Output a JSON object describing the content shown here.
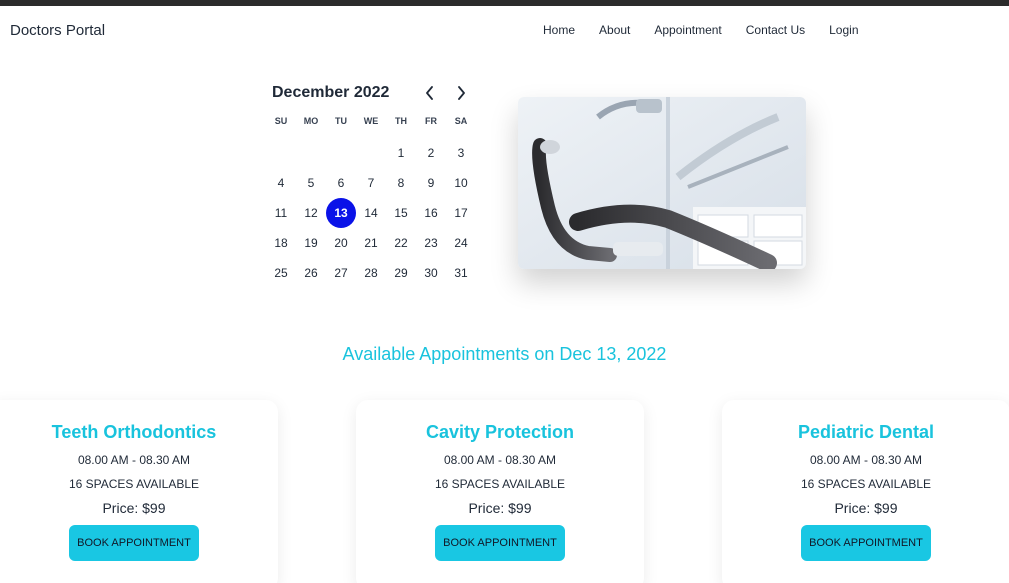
{
  "brand": "Doctors Portal",
  "nav": {
    "home": "Home",
    "about": "About",
    "appointment": "Appointment",
    "contact": "Contact Us",
    "login": "Login"
  },
  "calendar": {
    "month_label": "December 2022",
    "weekdays": [
      "SU",
      "MO",
      "TU",
      "WE",
      "TH",
      "FR",
      "SA"
    ],
    "leading_blanks": 4,
    "days": [
      "1",
      "2",
      "3",
      "4",
      "5",
      "6",
      "7",
      "8",
      "9",
      "10",
      "11",
      "12",
      "13",
      "14",
      "15",
      "16",
      "17",
      "18",
      "19",
      "20",
      "21",
      "22",
      "23",
      "24",
      "25",
      "26",
      "27",
      "28",
      "29",
      "30",
      "31"
    ],
    "selected_day": "13",
    "accent_color": "#0a12e8"
  },
  "hero": {
    "image_icon": "dental-chair-photo"
  },
  "available_title": "Available Appointments on Dec 13, 2022",
  "services": [
    {
      "name": "Teeth Orthodontics",
      "time": "08.00 AM - 08.30 AM",
      "spaces": "16 SPACES AVAILABLE",
      "price": "Price: $99",
      "button": "BOOK APPOINTMENT"
    },
    {
      "name": "Cavity Protection",
      "time": "08.00 AM - 08.30 AM",
      "spaces": "16 SPACES AVAILABLE",
      "price": "Price: $99",
      "button": "BOOK APPOINTMENT"
    },
    {
      "name": "Pediatric Dental",
      "time": "08.00 AM - 08.30 AM",
      "spaces": "16 SPACES AVAILABLE",
      "price": "Price: $99",
      "button": "BOOK APPOINTMENT"
    }
  ],
  "colors": {
    "accent": "#19c3dd",
    "button": "#19c7e3"
  }
}
